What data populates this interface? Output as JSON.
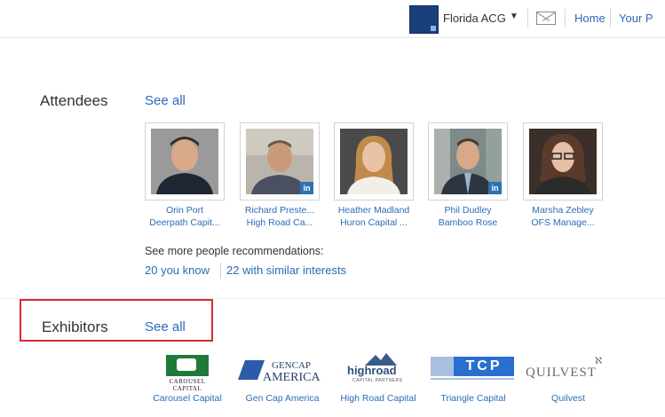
{
  "header": {
    "org_name": "Florida ACG",
    "links": [
      "Home",
      "Your P"
    ]
  },
  "attendees": {
    "title": "Attendees",
    "see_all": "See all",
    "people": [
      {
        "name": "Orin Port",
        "company": "Deerpath Capit...",
        "linkedin": false
      },
      {
        "name": "Richard Preste...",
        "company": "High Road Ca...",
        "linkedin": true
      },
      {
        "name": "Heather Madland",
        "company": "Huron Capital ...",
        "linkedin": false
      },
      {
        "name": "Phil Dudley",
        "company": "Bamboo Rose",
        "linkedin": true
      },
      {
        "name": "Marsha Zebley",
        "company": "OFS Manage...",
        "linkedin": false
      }
    ],
    "more_text": "See more people recommendations:",
    "more_links": [
      "20 you know",
      "22 with similar interests"
    ],
    "linkedin_badge": "in"
  },
  "exhibitors": {
    "title": "Exhibitors",
    "see_all": "See all",
    "items": [
      {
        "name": "Carousel Capital",
        "logo_text": "CAROUSEL CAPITAL"
      },
      {
        "name": "Gen Cap America",
        "logo_text_1": "GENCAP",
        "logo_text_2": "AMERICA"
      },
      {
        "name": "High Road Capital",
        "logo_text": "highroad",
        "logo_sub": "CAPITAL PARTNERS"
      },
      {
        "name": "Triangle Capital",
        "logo_text": "TCP"
      },
      {
        "name": "Quilvest",
        "logo_text": "QUILVEST"
      }
    ]
  },
  "colors": {
    "link": "#2b6cb5",
    "highlight": "#d92a2a",
    "linkedin": "#2b73b3"
  }
}
